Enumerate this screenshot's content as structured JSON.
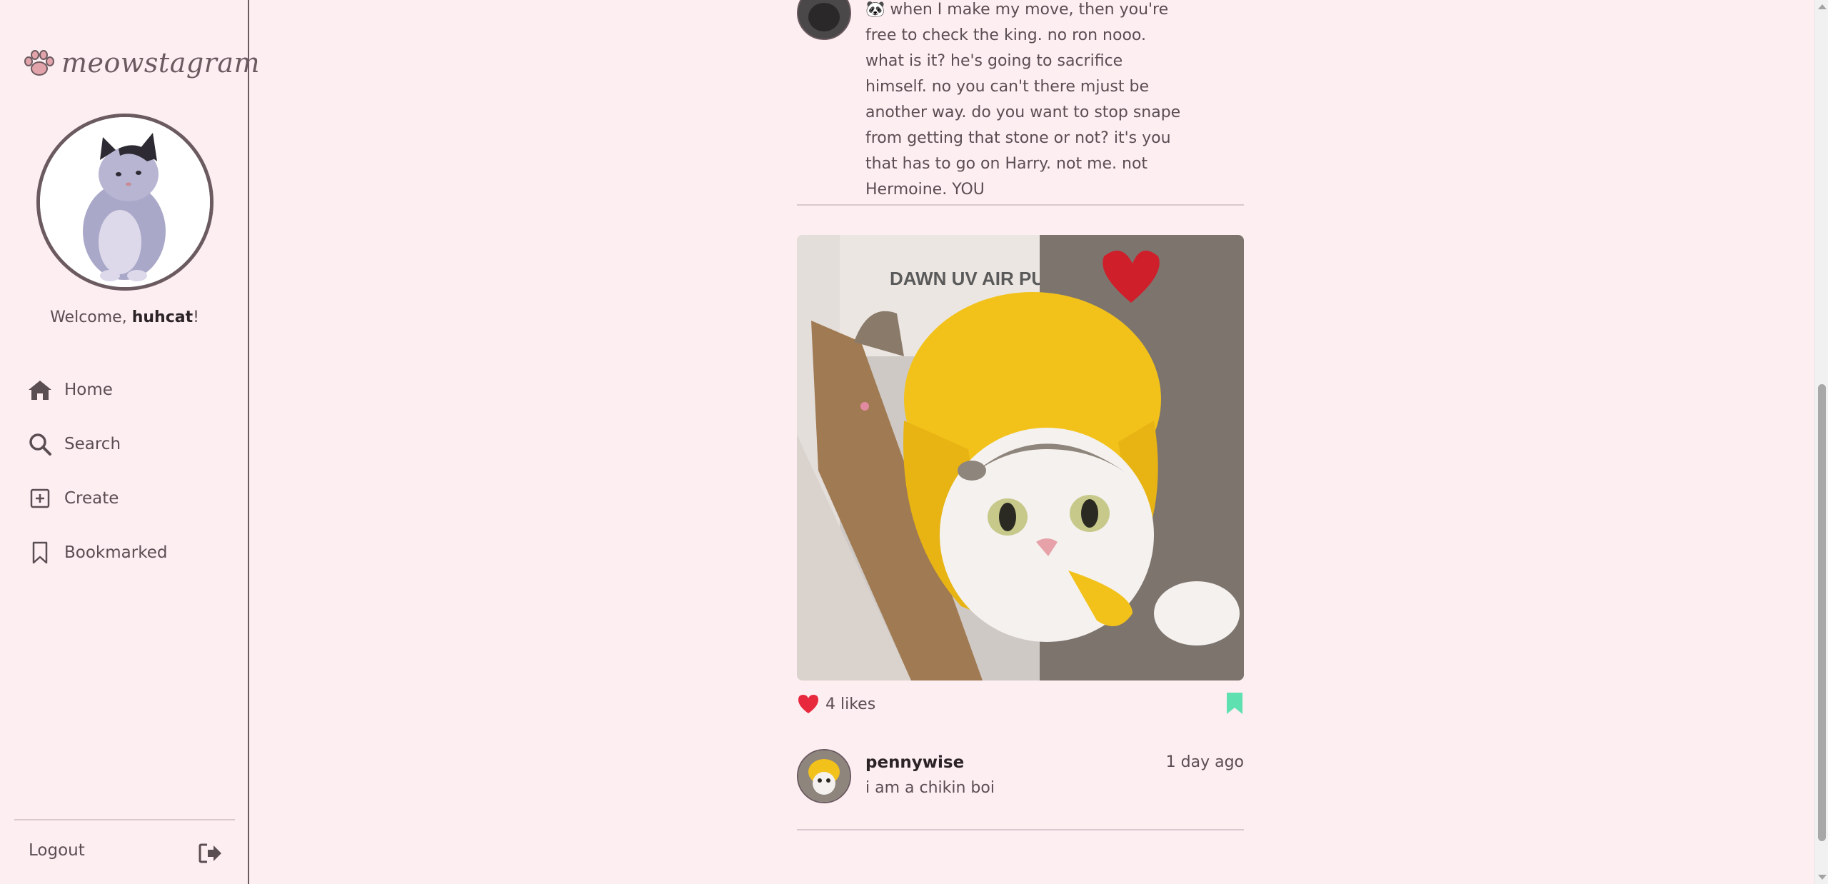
{
  "app": {
    "logo_text": "meowstagram"
  },
  "user": {
    "welcome_prefix": "Welcome, ",
    "username": "huhcat",
    "welcome_suffix": "!"
  },
  "nav": {
    "items": [
      {
        "label": "Home",
        "icon": "home-icon"
      },
      {
        "label": "Search",
        "icon": "search-icon"
      },
      {
        "label": "Create",
        "icon": "plus-square-icon"
      },
      {
        "label": "Bookmarked",
        "icon": "bookmark-icon"
      }
    ],
    "logout_label": "Logout"
  },
  "feed": {
    "previous_comment": {
      "text": "🐼 when I make my move, then you're free to check the king. no ron nooo. what is it? he's going to sacrifice himself. no you can't there mjust be another way. do you want to stop snape from getting that stone or not? it's you that has to go on Harry. not me. not Hermoine. YOU"
    },
    "post": {
      "likes_text": "4 likes",
      "liked": true,
      "bookmarked": true,
      "author": "pennywise",
      "time_ago": "1 day ago",
      "caption": "i am a chikin boi"
    }
  },
  "colors": {
    "background": "#fdeef2",
    "text": "#5a4e52",
    "heart": "#e8283c",
    "bookmark": "#5ee0b0",
    "border": "#6b5b60"
  }
}
